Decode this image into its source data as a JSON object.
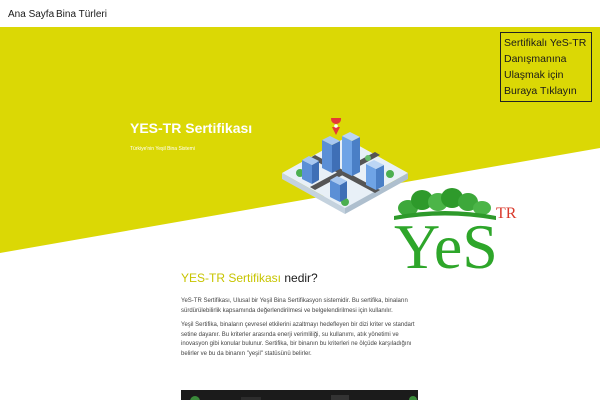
{
  "nav": {
    "home": "Ana Sayfa",
    "building_types": "Bina Türleri"
  },
  "consult_box": {
    "lines": [
      "Sertifikalı YeS-TR",
      "Danışmanına",
      "Ulaşmak için",
      "Buraya Tıklayın"
    ]
  },
  "hero": {
    "title": "YES-TR Sertifikası",
    "subtitle": "Türkiye'nin Yeşil Bina Sistemi"
  },
  "logo": {
    "main_text": "YeS",
    "superscript": "TR"
  },
  "section": {
    "heading_accent": "YES-TR Sertifikası",
    "heading_rest": " nedir?",
    "paragraphs": [
      "YeS-TR Sertifikası, Ulusal bir Yeşil Bina Sertifikasyon sistemidir. Bu sertifika, binaların sürdürülebilirlik kapsamında değerlendirilmesi ve belgelendirilmesi için kullanılır.",
      "Yeşil Sertifika, binaların çevresel etkilerini azaltmayı hedefleyen bir dizi kriter ve standart setine dayanır. Bu kriterler arasında enerji verimliliği, su kullanımı, atık yönetimi ve inovasyon gibi konular bulunur. Sertifika, bir binanın bu kriterleri ne ölçüde karşıladığını belirler ve bu da binanın \"yeşil\" statüsünü belirler."
    ]
  },
  "colors": {
    "hero_yellow": "#dbd805",
    "heading_accent": "#c7c400",
    "logo_green": "#2ea62a",
    "logo_red": "#d9392b"
  }
}
